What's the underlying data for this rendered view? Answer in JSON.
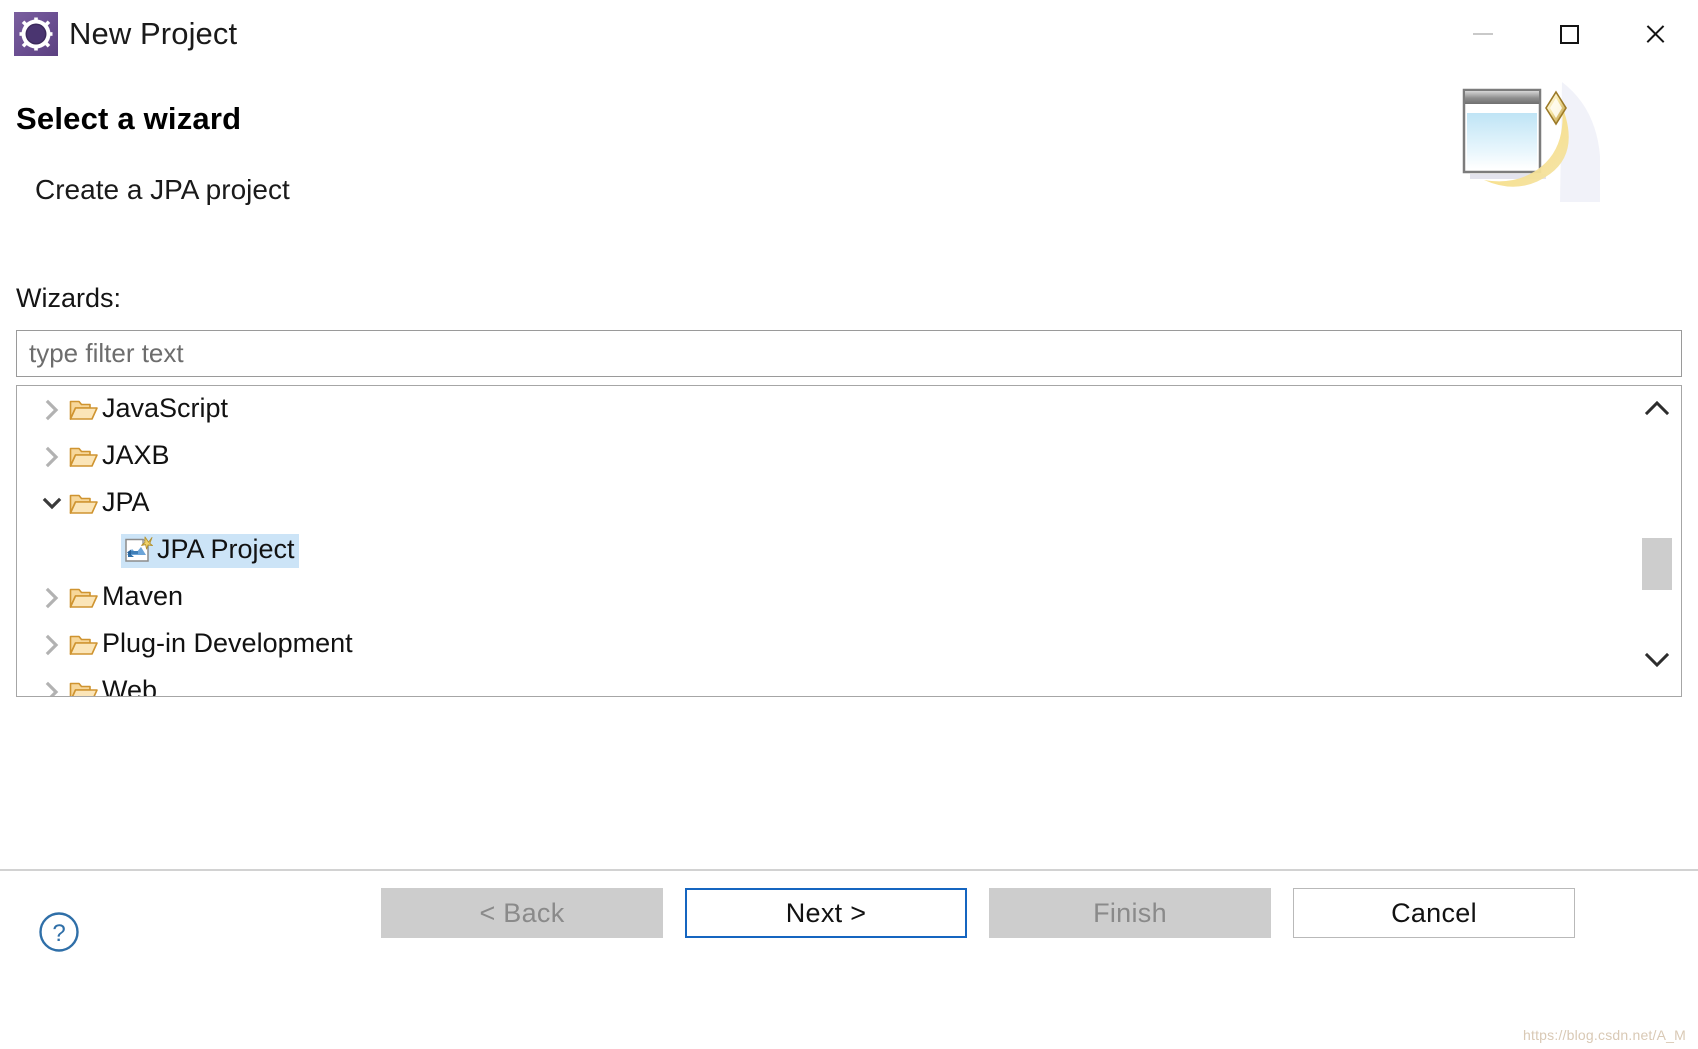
{
  "window": {
    "title": "New Project",
    "icon": "project-gear-icon",
    "controls": {
      "minimize": "minimize-icon",
      "maximize": "maximize-icon",
      "close": "close-icon"
    }
  },
  "header": {
    "title": "Select a wizard",
    "subtitle": "Create a JPA project",
    "banner_icon": "wizard-window-sparkle-icon"
  },
  "main": {
    "wizards_label": "Wizards:",
    "filter": {
      "value": "",
      "placeholder": "type filter text"
    },
    "tree": [
      {
        "label": "JavaScript",
        "level": 0,
        "state": "collapsed",
        "icon": "folder-icon",
        "selected": false
      },
      {
        "label": "JAXB",
        "level": 0,
        "state": "collapsed",
        "icon": "folder-icon",
        "selected": false
      },
      {
        "label": "JPA",
        "level": 0,
        "state": "expanded",
        "icon": "folder-icon",
        "selected": false
      },
      {
        "label": "JPA Project",
        "level": 1,
        "state": "leaf",
        "icon": "jpa-project-icon",
        "selected": true
      },
      {
        "label": "Maven",
        "level": 0,
        "state": "collapsed",
        "icon": "folder-icon",
        "selected": false
      },
      {
        "label": "Plug-in Development",
        "level": 0,
        "state": "collapsed",
        "icon": "folder-icon",
        "selected": false
      },
      {
        "label": "Web",
        "level": 0,
        "state": "collapsed",
        "icon": "folder-icon",
        "selected": false
      }
    ],
    "scrollbar": {
      "up_icon": "chevron-up-icon",
      "down_icon": "chevron-down-icon"
    }
  },
  "footer": {
    "help_icon": "help-question-icon",
    "buttons": [
      {
        "label": "< Back",
        "state": "disabled"
      },
      {
        "label": "Next >",
        "state": "focused"
      },
      {
        "label": "Finish",
        "state": "disabled"
      },
      {
        "label": "Cancel",
        "state": "enabled"
      }
    ]
  },
  "watermark": "https://blog.csdn.net/A_M",
  "colors": {
    "selection": "#cce4f7",
    "focus_border": "#1565c0",
    "disabled_button": "#cdcdcd",
    "folder": "#e8a33d",
    "title_icon": "#6b4f92"
  }
}
